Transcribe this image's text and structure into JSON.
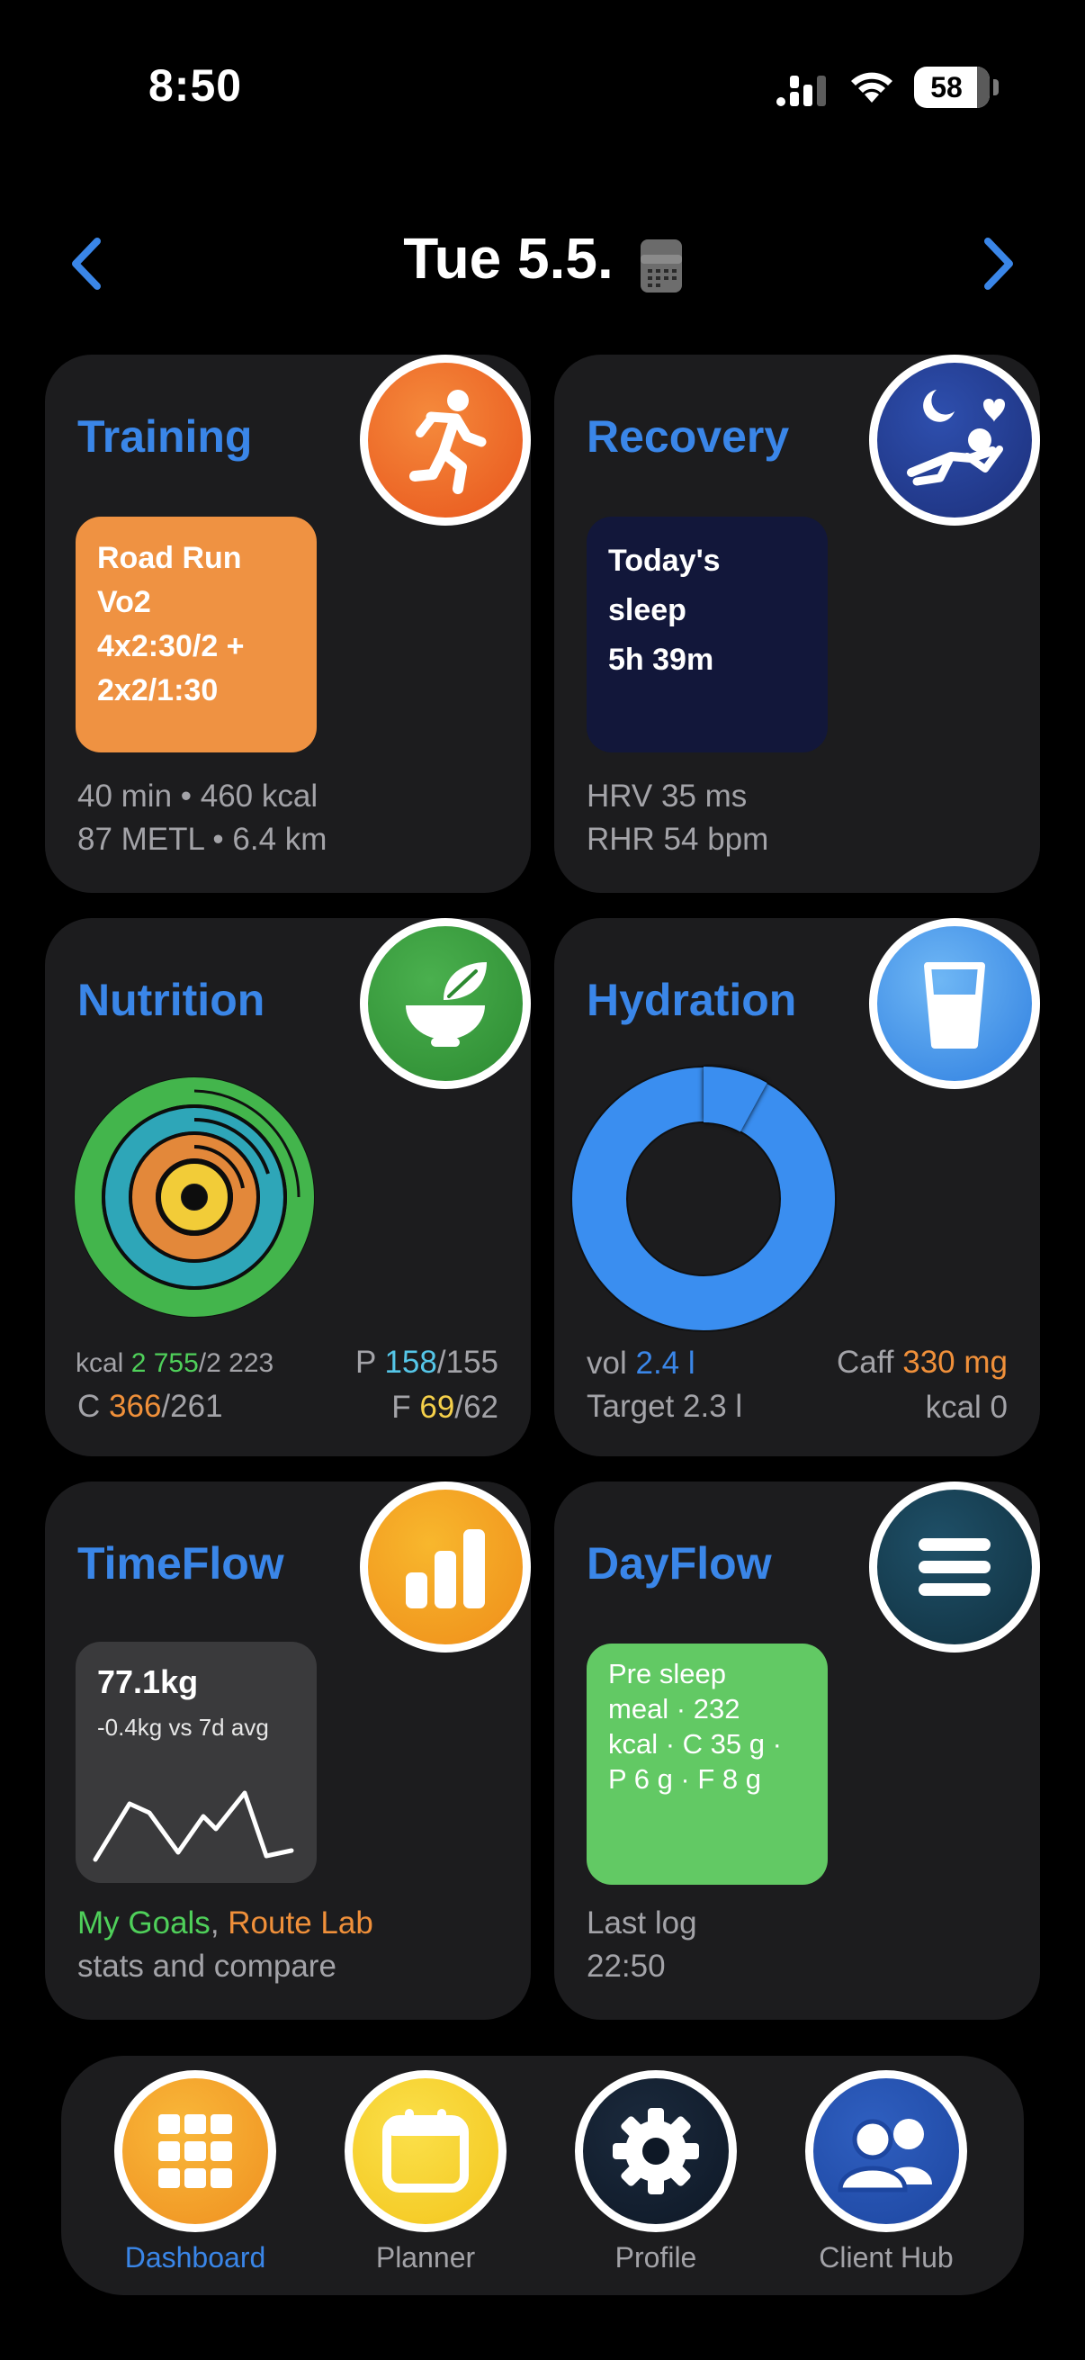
{
  "status_bar": {
    "time": "8:50",
    "battery": "58"
  },
  "header": {
    "date": "Tue 5.5."
  },
  "training": {
    "title": "Training",
    "workout_lines": [
      "Road Run",
      "Vo2",
      "4x2:30/2 +",
      "2x2/1:30"
    ],
    "line1": "40 min • 460 kcal",
    "line2": "87 METL • 6.4 km",
    "tile_color": "#ef9242",
    "icon_color": "#ee6a22"
  },
  "recovery": {
    "title": "Recovery",
    "sleep_lines": [
      "Today's",
      "sleep",
      "5h 39m"
    ],
    "line1": "HRV 35 ms",
    "line2": "RHR 54 bpm",
    "tile_color": "#12173a",
    "icon_color": "#253d95"
  },
  "nutrition": {
    "title": "Nutrition",
    "kcal_label": "kcal",
    "kcal_value": "2 755",
    "kcal_target": "/2 223",
    "protein_label": "P",
    "protein_value": "158",
    "protein_target": "/155",
    "carbs_label": "C",
    "carbs_value": "366",
    "carbs_target": "/261",
    "fat_label": "F",
    "fat_value": "69",
    "fat_target": "/62",
    "icon_color": "#3a9a3d"
  },
  "hydration": {
    "title": "Hydration",
    "vol_label": "vol",
    "vol_value": "2.4 l",
    "caff_label": "Caff",
    "caff_value": "330 mg",
    "target": "Target 2.3 l",
    "kcal": "kcal 0",
    "progress": 1.04,
    "icon_color": "#3a8ae8"
  },
  "timeflow": {
    "title": "TimeFlow",
    "weight": "77.1kg",
    "delta": "-0.4kg vs 7d avg",
    "goals_link": "My Goals",
    "separator": ",",
    "route_link": "Route Lab",
    "subtitle": "stats and compare",
    "icon_color": "#f3a321"
  },
  "dayflow": {
    "title": "DayFlow",
    "entry_lines": [
      "Pre sleep",
      "meal · 232",
      "kcal · C 35 g ·",
      "P 6 g · F 8 g"
    ],
    "last_log_label": "Last log",
    "last_log_time": "22:50",
    "tile_color": "#62c964",
    "icon_color": "#163b52"
  },
  "tabbar": {
    "items": [
      {
        "label": "Dashboard",
        "active": true
      },
      {
        "label": "Planner",
        "active": false
      },
      {
        "label": "Profile",
        "active": false
      },
      {
        "label": "Client Hub",
        "active": false
      }
    ]
  },
  "colors": {
    "accent": "#3a86e8",
    "green": "#4fd05a",
    "cyan": "#55c6e8",
    "orange": "#f0903a",
    "yellow": "#f5d04a"
  }
}
